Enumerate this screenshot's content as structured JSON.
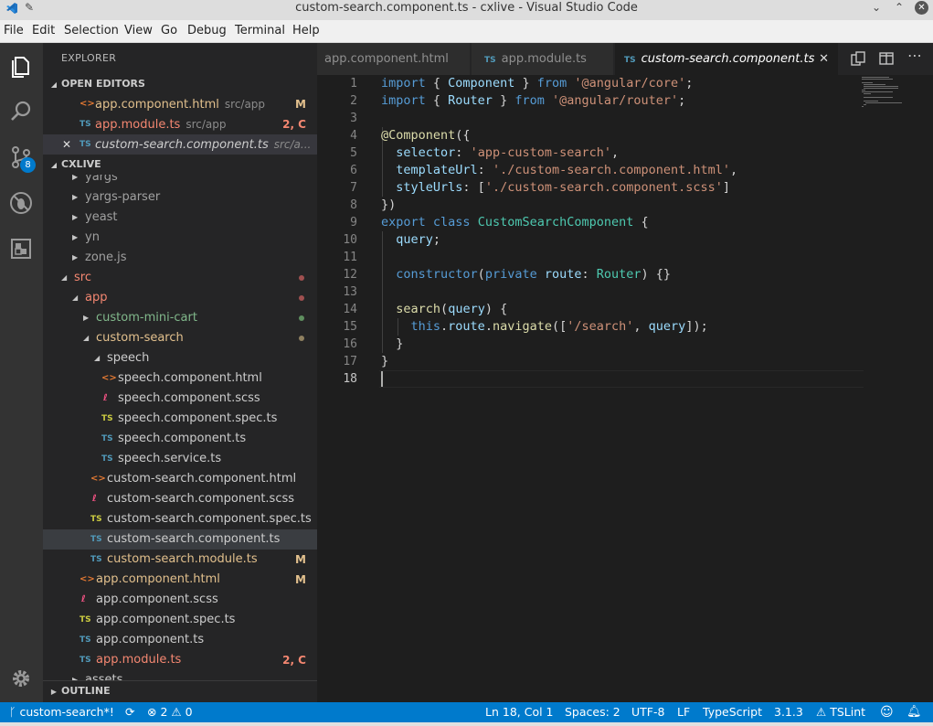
{
  "window": {
    "title": "custom-search.component.ts - cxlive - Visual Studio Code"
  },
  "menu": [
    "File",
    "Edit",
    "Selection",
    "View",
    "Go",
    "Debug",
    "Terminal",
    "Help"
  ],
  "activity": {
    "scm_badge": "8"
  },
  "sidebar": {
    "header": "EXPLORER",
    "open_editors_title": "OPEN EDITORS",
    "open_editors": [
      {
        "icon": "<>",
        "name": "app.component.html",
        "path": "src/app",
        "deco": "M"
      },
      {
        "icon": "TS",
        "name": "app.module.ts",
        "path": "src/app",
        "deco": "2, C"
      },
      {
        "icon": "TS",
        "name": "custom-search.component.ts",
        "path": "src/a...",
        "close": "✕"
      }
    ],
    "workspace_title": "CXLIVE",
    "tree": [
      {
        "name": "yargs"
      },
      {
        "name": "yargs-parser"
      },
      {
        "name": "yeast"
      },
      {
        "name": "yn"
      },
      {
        "name": "zone.js"
      },
      {
        "name": "src"
      },
      {
        "name": "app"
      },
      {
        "name": "custom-mini-cart"
      },
      {
        "name": "custom-search"
      },
      {
        "name": "speech"
      },
      {
        "icon": "<>",
        "name": "speech.component.html"
      },
      {
        "icon": "ℓ",
        "name": "speech.component.scss"
      },
      {
        "icon": "TS",
        "name": "speech.component.spec.ts"
      },
      {
        "icon": "TS",
        "name": "speech.component.ts"
      },
      {
        "icon": "TS",
        "name": "speech.service.ts"
      },
      {
        "icon": "<>",
        "name": "custom-search.component.html"
      },
      {
        "icon": "ℓ",
        "name": "custom-search.component.scss"
      },
      {
        "icon": "TS",
        "name": "custom-search.component.spec.ts"
      },
      {
        "icon": "TS",
        "name": "custom-search.component.ts"
      },
      {
        "icon": "TS",
        "name": "custom-search.module.ts",
        "deco": "M"
      },
      {
        "icon": "<>",
        "name": "app.component.html",
        "deco": "M"
      },
      {
        "icon": "ℓ",
        "name": "app.component.scss"
      },
      {
        "icon": "TS",
        "name": "app.component.spec.ts"
      },
      {
        "icon": "TS",
        "name": "app.component.ts"
      },
      {
        "icon": "TS",
        "name": "app.module.ts",
        "deco": "2, C"
      },
      {
        "name": "assets"
      }
    ],
    "outline_title": "OUTLINE"
  },
  "tabs": [
    {
      "label": "app.component.html"
    },
    {
      "icon": "TS",
      "label": "app.module.ts"
    },
    {
      "icon": "TS",
      "label": "custom-search.component.ts",
      "close": "✕"
    }
  ],
  "editor": {
    "line_numbers": [
      "1",
      "2",
      "3",
      "4",
      "5",
      "6",
      "7",
      "8",
      "9",
      "10",
      "11",
      "12",
      "13",
      "14",
      "15",
      "16",
      "17",
      "18"
    ],
    "lines": [
      [
        [
          "k",
          "import"
        ],
        [
          "p",
          " { "
        ],
        [
          "v",
          "Component"
        ],
        [
          "p",
          " } "
        ],
        [
          "k",
          "from"
        ],
        [
          "p",
          " "
        ],
        [
          "s",
          "'@angular/core'"
        ],
        [
          "p",
          ";"
        ]
      ],
      [
        [
          "k",
          "import"
        ],
        [
          "p",
          " { "
        ],
        [
          "v",
          "Router"
        ],
        [
          "p",
          " } "
        ],
        [
          "k",
          "from"
        ],
        [
          "p",
          " "
        ],
        [
          "s",
          "'@angular/router'"
        ],
        [
          "p",
          ";"
        ]
      ],
      [],
      [
        [
          "f",
          "@Component"
        ],
        [
          "p",
          "({"
        ]
      ],
      [
        [
          "p",
          "  "
        ],
        [
          "v",
          "selector"
        ],
        [
          "p",
          ": "
        ],
        [
          "s",
          "'app-custom-search'"
        ],
        [
          "p",
          ","
        ]
      ],
      [
        [
          "p",
          "  "
        ],
        [
          "v",
          "templateUrl"
        ],
        [
          "p",
          ": "
        ],
        [
          "s",
          "'./custom-search.component.html'"
        ],
        [
          "p",
          ","
        ]
      ],
      [
        [
          "p",
          "  "
        ],
        [
          "v",
          "styleUrls"
        ],
        [
          "p",
          ": ["
        ],
        [
          "s",
          "'./custom-search.component.scss'"
        ],
        [
          "p",
          "]"
        ]
      ],
      [
        [
          "p",
          "})"
        ]
      ],
      [
        [
          "k",
          "export"
        ],
        [
          "p",
          " "
        ],
        [
          "k",
          "class"
        ],
        [
          "p",
          " "
        ],
        [
          "t",
          "CustomSearchComponent"
        ],
        [
          "p",
          " {"
        ]
      ],
      [
        [
          "p",
          "  "
        ],
        [
          "v",
          "query"
        ],
        [
          "p",
          ";"
        ]
      ],
      [],
      [
        [
          "p",
          "  "
        ],
        [
          "k",
          "constructor"
        ],
        [
          "p",
          "("
        ],
        [
          "k",
          "private"
        ],
        [
          "p",
          " "
        ],
        [
          "v",
          "route"
        ],
        [
          "p",
          ": "
        ],
        [
          "t",
          "Router"
        ],
        [
          "p",
          ") {}"
        ]
      ],
      [],
      [
        [
          "p",
          "  "
        ],
        [
          "f",
          "search"
        ],
        [
          "p",
          "("
        ],
        [
          "v",
          "query"
        ],
        [
          "p",
          ") {"
        ]
      ],
      [
        [
          "p",
          "    "
        ],
        [
          "k",
          "this"
        ],
        [
          "p",
          "."
        ],
        [
          "v",
          "route"
        ],
        [
          "p",
          "."
        ],
        [
          "f",
          "navigate"
        ],
        [
          "p",
          "(["
        ],
        [
          "s",
          "'/search'"
        ],
        [
          "p",
          ", "
        ],
        [
          "v",
          "query"
        ],
        [
          "p",
          "]);"
        ]
      ],
      [
        [
          "p",
          "  }"
        ]
      ],
      [
        [
          "p",
          "}"
        ]
      ],
      []
    ]
  },
  "status": {
    "branch": "custom-search*!",
    "sync_icon": "⟳",
    "errors": "2",
    "warnings": "0",
    "position": "Ln 18, Col 1",
    "spaces": "Spaces: 2",
    "encoding": "UTF-8",
    "eol": "LF",
    "language": "TypeScript",
    "version": "3.1.3",
    "linter": "TSLint"
  }
}
